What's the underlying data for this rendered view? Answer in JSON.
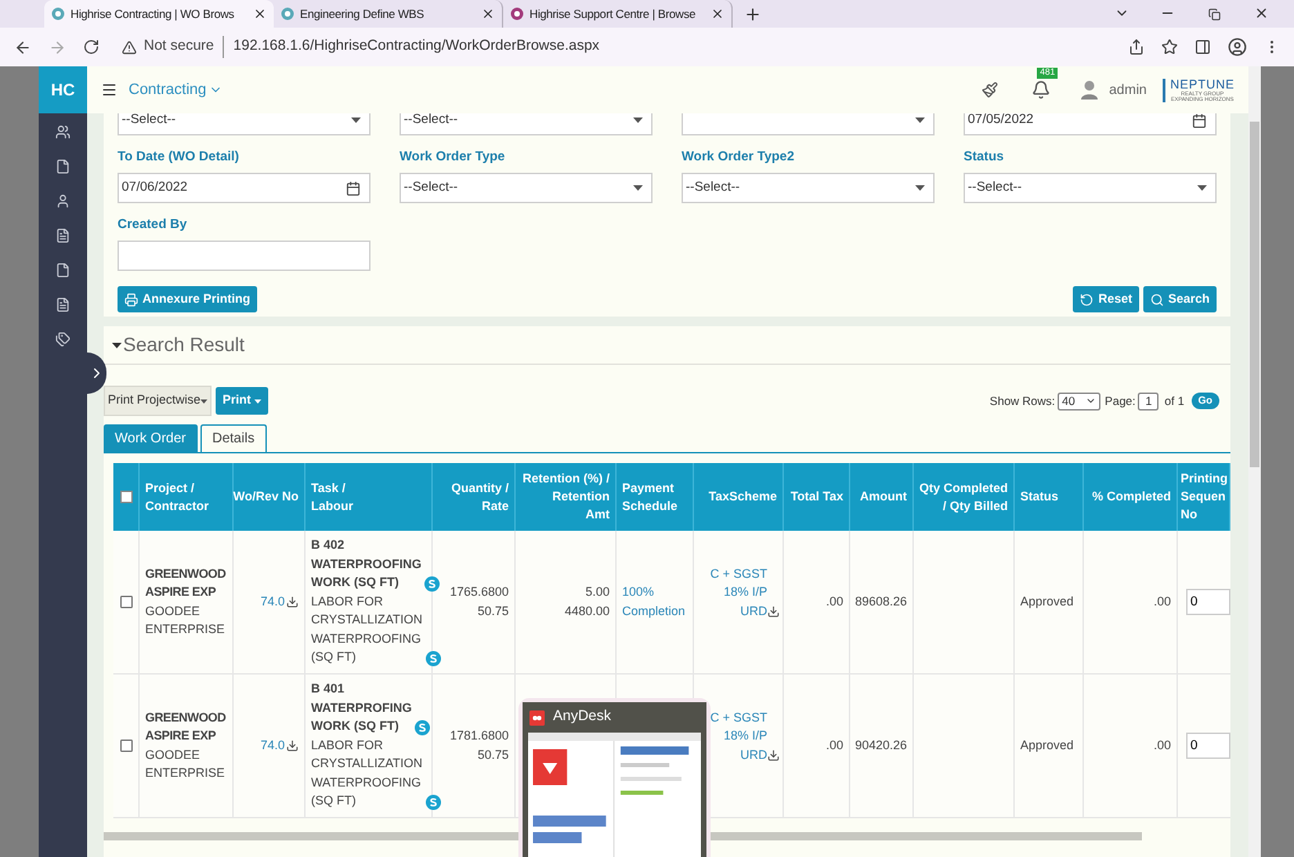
{
  "browser": {
    "tabs": [
      {
        "title": "Highrise Contracting | WO Brows",
        "selected": true
      },
      {
        "title": "Engineering Define WBS",
        "selected": false
      },
      {
        "title": "Highrise Support Centre | Browse",
        "selected": false
      }
    ],
    "security": "Not secure",
    "url": "192.168.1.6/HighriseContracting/WorkOrderBrowse.aspx"
  },
  "header": {
    "logo": "HC",
    "module": "Contracting",
    "notifications": "481",
    "user": "admin",
    "brand": {
      "name": "NEPTUNE",
      "line1": "REALTY GROUP",
      "line2": "EXPANDING HORIZONS"
    }
  },
  "filters_top": [
    {
      "kind": "select",
      "value": "--Select--"
    },
    {
      "kind": "select",
      "value": "--Select--"
    },
    {
      "kind": "select"
    },
    {
      "kind": "date",
      "value": "07/05/2022"
    }
  ],
  "filters": [
    {
      "label": "To Date (WO Detail)",
      "kind": "date",
      "value": "07/06/2022"
    },
    {
      "label": "Work Order Type",
      "kind": "select",
      "value": "--Select--"
    },
    {
      "label": "Work Order Type2",
      "kind": "select",
      "value": "--Select--"
    },
    {
      "label": "Status",
      "kind": "select",
      "value": "--Select--"
    },
    {
      "label": "Created By",
      "kind": "text"
    }
  ],
  "actions": {
    "annexure": "Annexure Printing",
    "reset": "Reset",
    "search": "Search"
  },
  "results": {
    "title": "Search Result",
    "print_mode": "Print Projectwise",
    "print": "Print",
    "show_rows_label": "Show Rows:",
    "rows_per_page": "40",
    "page_label": "Page:",
    "page": "1",
    "page_total": "of 1",
    "go": "Go",
    "tabs": [
      {
        "label": "Work Order",
        "selected": true
      },
      {
        "label": "Details",
        "selected": false
      }
    ],
    "select_all": false,
    "columns": [
      [
        "Project /",
        "Contractor"
      ],
      [
        "Wo/Rev No"
      ],
      [
        "Task /",
        "Labour"
      ],
      [
        "Quantity /",
        "Rate"
      ],
      [
        "Retention (%) /",
        "Retention",
        "Amt"
      ],
      [
        "Payment",
        "Schedule"
      ],
      [
        "TaxScheme"
      ],
      [
        "Total Tax"
      ],
      [
        "Amount"
      ],
      [
        "Qty Completed",
        "/ Qty Billed"
      ],
      [
        "Status"
      ],
      [
        "% Completed"
      ],
      [
        "Printing",
        "Sequen",
        "No"
      ]
    ],
    "rows": [
      {
        "checked": false,
        "project": "GREENWOOD ASPIRE EXP",
        "contractor": "GOODEE ENTERPRISE",
        "wo": "74.0",
        "task": "B 402 WATERPROOFING WORK (SQ FT)",
        "labour": "LABOR FOR CRYSTALLIZATION WATERPROOFING (SQ FT)",
        "quantity": "1765.6800",
        "rate": "50.75",
        "retention_pct": "5.00",
        "retention_amt": "4480.00",
        "payment": "100% Completion",
        "tax": "C + SGST 18% I/P URD",
        "total_tax": ".00",
        "amount": "89608.26",
        "status": "Approved",
        "completed": ".00",
        "sequence": "0"
      },
      {
        "checked": false,
        "project": "GREENWOOD ASPIRE EXP",
        "contractor": "GOODEE ENTERPRISE",
        "wo": "74.0",
        "task": "B 401 WATERPROFING WORK (SQ FT)",
        "labour": "LABOR FOR CRYSTALLIZATION WATERPROOFING (SQ FT)",
        "quantity": "1781.6800",
        "rate": "50.75",
        "tax": "C + SGST 18% I/P URD",
        "total_tax": ".00",
        "amount": "90420.26",
        "status": "Approved",
        "completed": ".00",
        "sequence": "0"
      }
    ]
  },
  "popup": {
    "title": "AnyDesk"
  }
}
